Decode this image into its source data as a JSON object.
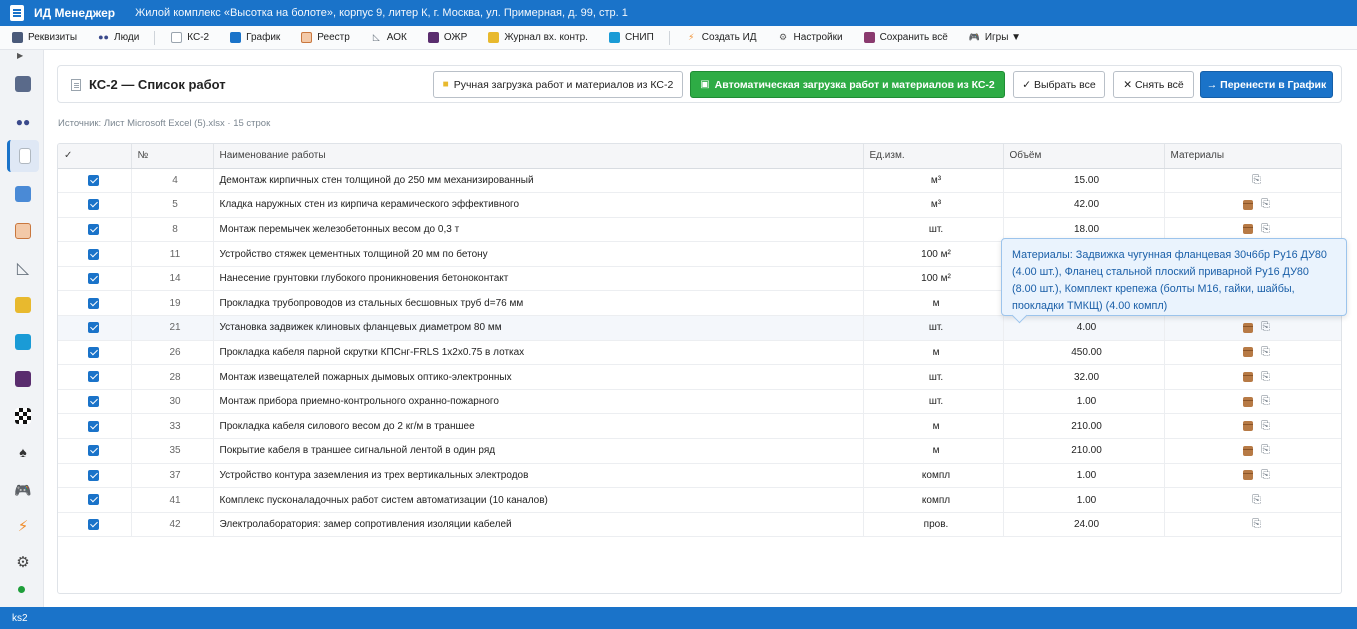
{
  "titlebar": {
    "app_name": "ИД Менеджер",
    "project": "Жилой комплекс «Высотка на болоте», корпус 9, литер К, г. Москва, ул. Примерная, д. 99, стр. 1"
  },
  "menu": {
    "items": [
      {
        "label": "Реквизиты",
        "icon": "folder-icon",
        "color": "#4a5a7a"
      },
      {
        "label": "Люди",
        "icon": "people-icon",
        "color": "#3b4a8c"
      },
      {
        "label": "КС-2",
        "icon": "document-icon",
        "color": "#9aa4ae"
      },
      {
        "label": "График",
        "icon": "calendar-icon",
        "color": "#1a73c9"
      },
      {
        "label": "Реестр",
        "icon": "clipboard-icon",
        "color": "#c9773e"
      },
      {
        "label": "АОК",
        "icon": "ruler-icon",
        "color": "#6b7580"
      },
      {
        "label": "ОЖР",
        "icon": "book-icon",
        "color": "#5a2d6e"
      },
      {
        "label": "Журнал вх. контр.",
        "icon": "notebook-icon",
        "color": "#e8b92e"
      },
      {
        "label": "СНИП",
        "icon": "blue-book-icon",
        "color": "#1a9bd6"
      },
      {
        "label": "Создать ИД",
        "icon": "lightning-icon",
        "color": "#f08c2a"
      },
      {
        "label": "Настройки",
        "icon": "gear-icon",
        "color": "#555555"
      },
      {
        "label": "Сохранить всё",
        "icon": "save-icon",
        "color": "#8a3a6e"
      },
      {
        "label": "Игры ▼",
        "icon": "gamepad-icon",
        "color": "#5a4aa8"
      }
    ]
  },
  "page": {
    "title": "КС-2 — Список работ",
    "source": "Источник: Лист Microsoft Excel (5).xlsx · 15 строк"
  },
  "buttons": {
    "manual": "Ручная загрузка работ и материалов из КС-2",
    "auto": "Автоматическая загрузка работ и материалов из КС-2",
    "select_all": "✓ Выбрать все",
    "clear_all": "✕ Снять всё",
    "transfer": "→ Перенести в График"
  },
  "table": {
    "headers": [
      "✓",
      "№",
      "Наименование работы",
      "Ед.изм.",
      "Объём",
      "Материалы"
    ],
    "rows": [
      {
        "checked": true,
        "num": "4",
        "name": "Демонтаж кирпичных стен толщиной до 250 мм механизированный",
        "unit": "м³",
        "volume": "15.00",
        "has_materials": false
      },
      {
        "checked": true,
        "num": "5",
        "name": "Кладка наружных стен из кирпича керамического эффективного",
        "unit": "м³",
        "volume": "42.00",
        "has_materials": true
      },
      {
        "checked": true,
        "num": "8",
        "name": "Монтаж перемычек железобетонных весом до 0,3 т",
        "unit": "шт.",
        "volume": "18.00",
        "has_materials": true
      },
      {
        "checked": true,
        "num": "11",
        "name": "Устройство стяжек цементных толщиной 20 мм по бетону",
        "unit": "100 м²",
        "volume": "",
        "has_materials": false
      },
      {
        "checked": true,
        "num": "14",
        "name": "Нанесение грунтовки глубокого проникновения бетоноконтакт",
        "unit": "100 м²",
        "volume": "",
        "has_materials": false
      },
      {
        "checked": true,
        "num": "19",
        "name": "Прокладка трубопроводов из стальных бесшовных труб d=76 мм",
        "unit": "м",
        "volume": "",
        "has_materials": false
      },
      {
        "checked": true,
        "num": "21",
        "name": "Установка задвижек клиновых фланцевых диаметром 80 мм",
        "unit": "шт.",
        "volume": "4.00",
        "has_materials": true
      },
      {
        "checked": true,
        "num": "26",
        "name": "Прокладка кабеля парной скрутки КПСнг-FRLS 1х2х0.75 в лотках",
        "unit": "м",
        "volume": "450.00",
        "has_materials": true
      },
      {
        "checked": true,
        "num": "28",
        "name": "Монтаж извещателей пожарных дымовых оптико-электронных",
        "unit": "шт.",
        "volume": "32.00",
        "has_materials": true
      },
      {
        "checked": true,
        "num": "30",
        "name": "Монтаж прибора приемно-контрольного охранно-пожарного",
        "unit": "шт.",
        "volume": "1.00",
        "has_materials": true
      },
      {
        "checked": true,
        "num": "33",
        "name": "Прокладка кабеля силового весом до 2 кг/м в траншее",
        "unit": "м",
        "volume": "210.00",
        "has_materials": true
      },
      {
        "checked": true,
        "num": "35",
        "name": "Покрытие кабеля в траншее сигнальной лентой в один ряд",
        "unit": "м",
        "volume": "210.00",
        "has_materials": true
      },
      {
        "checked": true,
        "num": "37",
        "name": "Устройство контура заземления из трех вертикальных электродов",
        "unit": "компл",
        "volume": "1.00",
        "has_materials": true
      },
      {
        "checked": true,
        "num": "41",
        "name": "Комплекс пусконаладочных работ систем автоматизации (10 каналов)",
        "unit": "компл",
        "volume": "1.00",
        "has_materials": false
      },
      {
        "checked": true,
        "num": "42",
        "name": "Электролаборатория: замер сопротивления изоляции кабелей",
        "unit": "пров.",
        "volume": "24.00",
        "has_materials": false
      }
    ]
  },
  "tooltip": {
    "text": "Материалы: Задвижка чугунная фланцевая 30ч6бр Ру16 ДУ80 (4.00 шт.), Фланец стальной плоский приварной Ру16 ДУ80 (8.00 шт.), Комплект крепежа (болты М16, гайки, шайбы, прокладки ТМКЩ) (4.00 компл)"
  },
  "statusbar": {
    "text": "ks2"
  },
  "colors": {
    "primary": "#1a73c9",
    "success": "#2eac45"
  }
}
